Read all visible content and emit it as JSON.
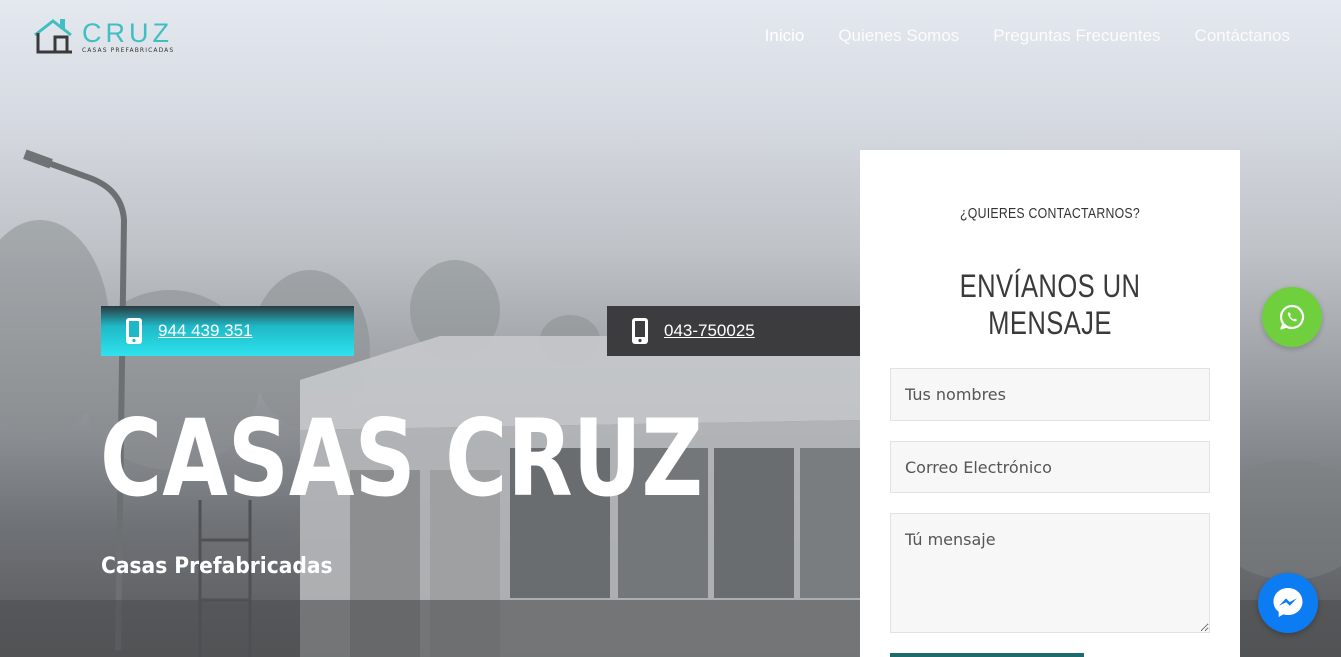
{
  "brand": {
    "name": "CRUZ",
    "tagline": "CASAS PREFABRICADAS",
    "accent": "#3fbfc2"
  },
  "nav": {
    "items": [
      {
        "label": "Inicio",
        "active": true
      },
      {
        "label": "Quienes Somos",
        "active": false
      },
      {
        "label": "Preguntas Frecuentes",
        "active": false
      },
      {
        "label": "Contáctanos",
        "active": false
      }
    ]
  },
  "hero": {
    "phones": [
      {
        "number": "944 439 351",
        "icon": "mobile-phone-icon",
        "color": "#2ee3ee"
      },
      {
        "number": "043-750025",
        "icon": "mobile-phone-icon",
        "color": "#3c3c3e"
      }
    ],
    "title": "CASAS CRUZ",
    "subtitle": "Casas Prefabricadas"
  },
  "contact_form": {
    "kicker": "¿QUIERES CONTACTARNOS?",
    "title": "ENVÍANOS UN MENSAJE",
    "fields": {
      "name_placeholder": "Tus nombres",
      "email_placeholder": "Correo Electrónico",
      "message_placeholder": "Tú mensaje"
    }
  },
  "floating": {
    "whatsapp": {
      "icon": "whatsapp-icon",
      "color": "#6fcf3d"
    },
    "messenger": {
      "icon": "messenger-icon",
      "color": "#0c7cf2"
    }
  }
}
